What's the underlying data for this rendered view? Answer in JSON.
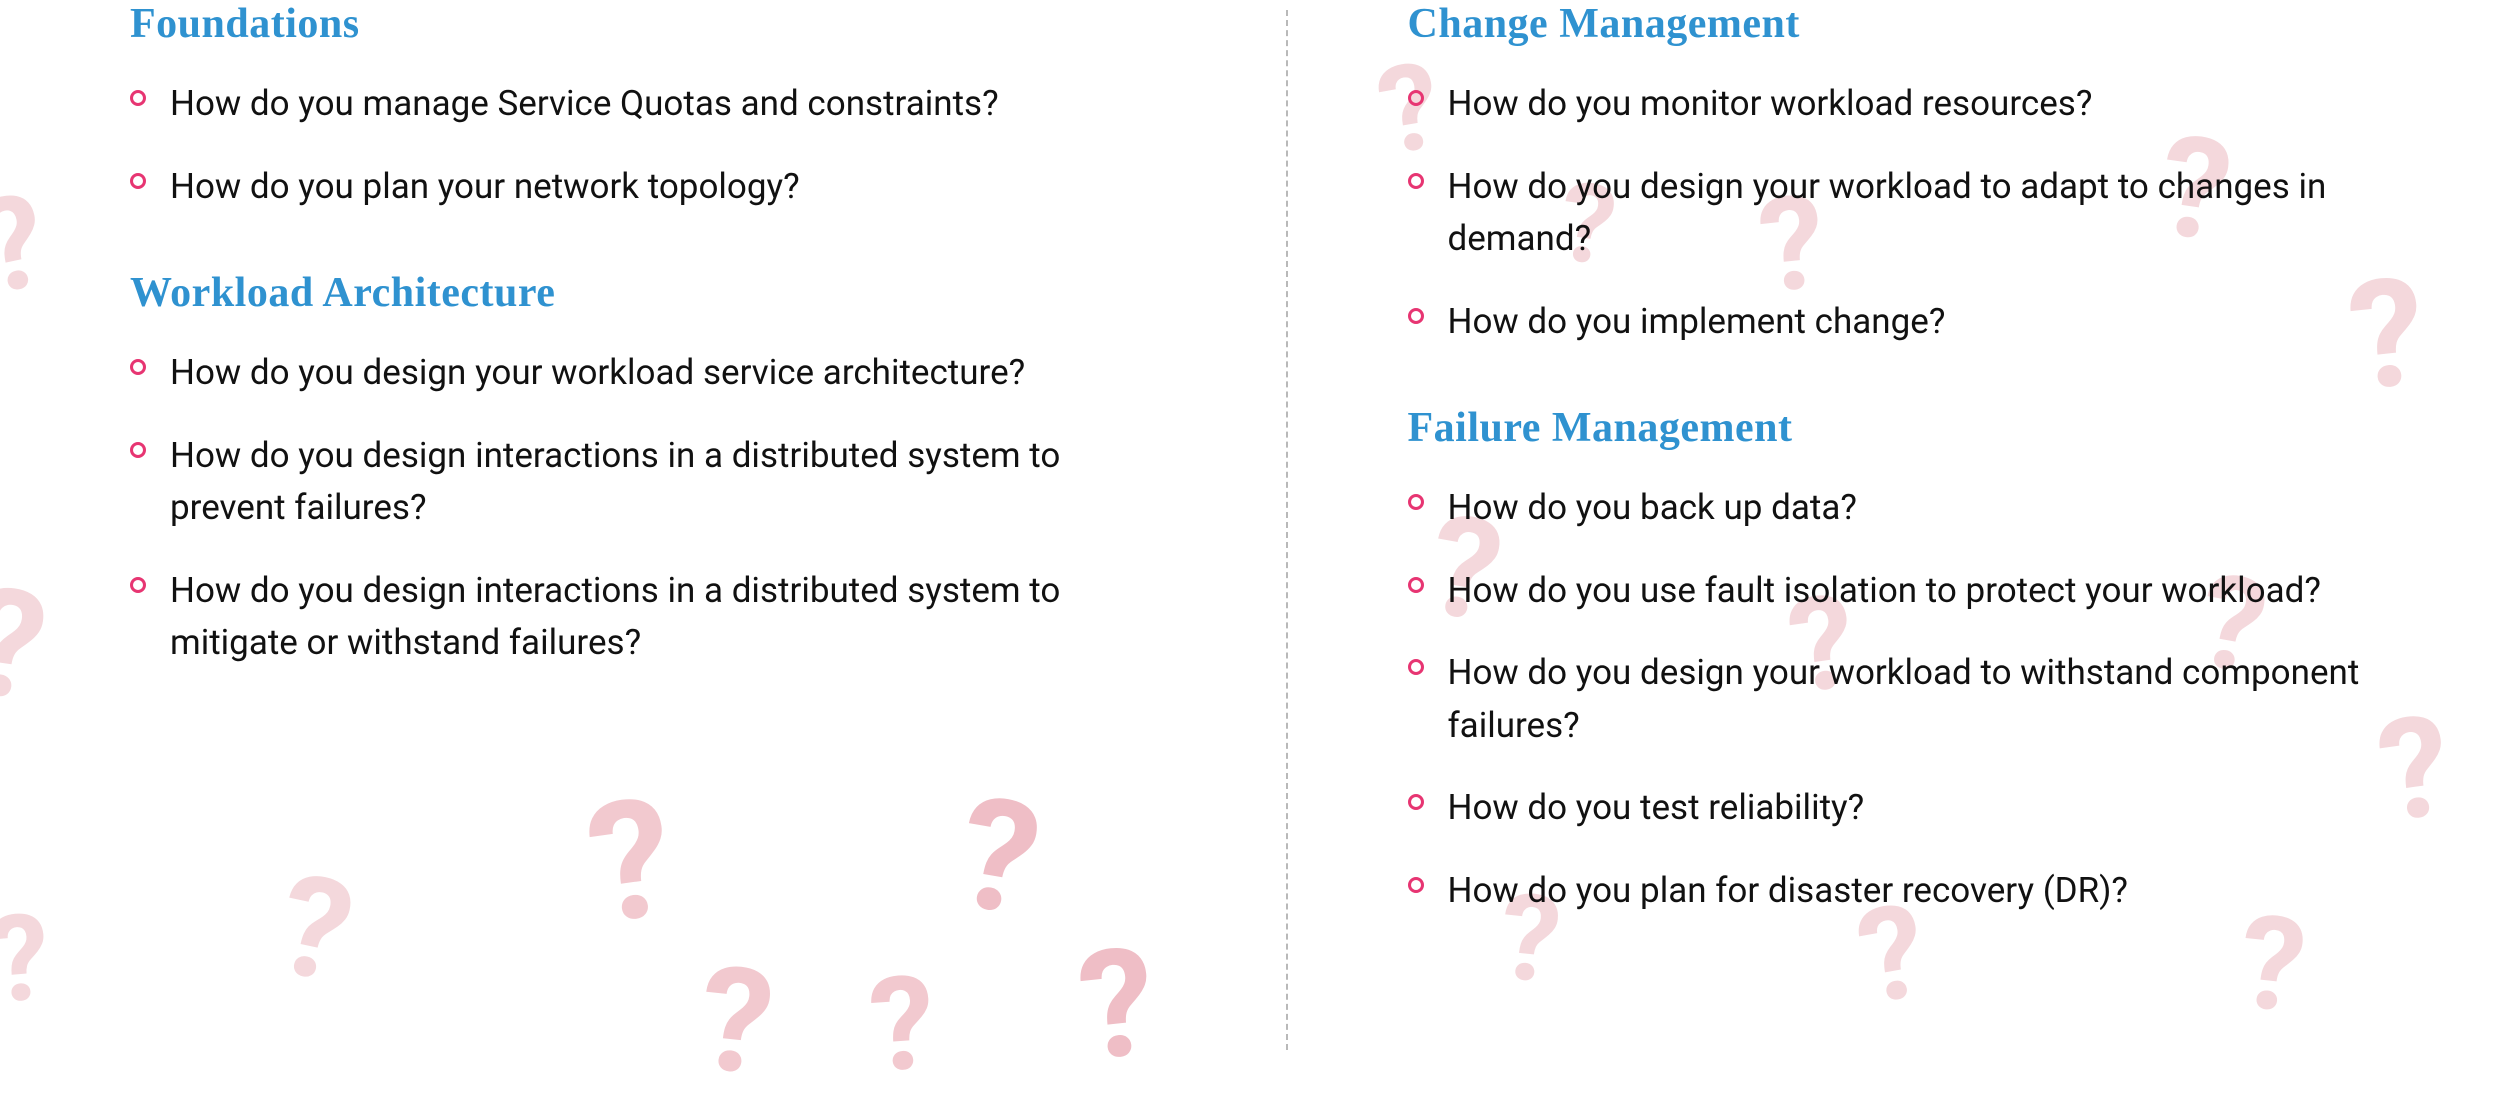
{
  "left": {
    "sections": [
      {
        "title": "Foundations",
        "items": [
          "How do you manage Service Quotas and constraints?",
          "How do you plan your network topology?"
        ]
      },
      {
        "title": "Workload Architecture",
        "items": [
          "How do you design your workload service architecture?",
          "How do you design interactions in a distributed system to prevent failures?",
          "How do you design interactions in a distributed system to mitigate or withstand failures?"
        ]
      }
    ]
  },
  "right": {
    "sections": [
      {
        "title": "Change Management",
        "items": [
          "How do you monitor workload resources?",
          "How do you design your workload to adapt to changes in demand?",
          "How do you implement change?"
        ]
      },
      {
        "title": "Failure Management",
        "items": [
          "How do you back up data?",
          "How do you use fault isolation to protect your workload?",
          "How do you design your workload to withstand component failures?",
          "How do you test reliability?",
          "How do you plan for disaster recovery (DR)?"
        ]
      }
    ]
  }
}
